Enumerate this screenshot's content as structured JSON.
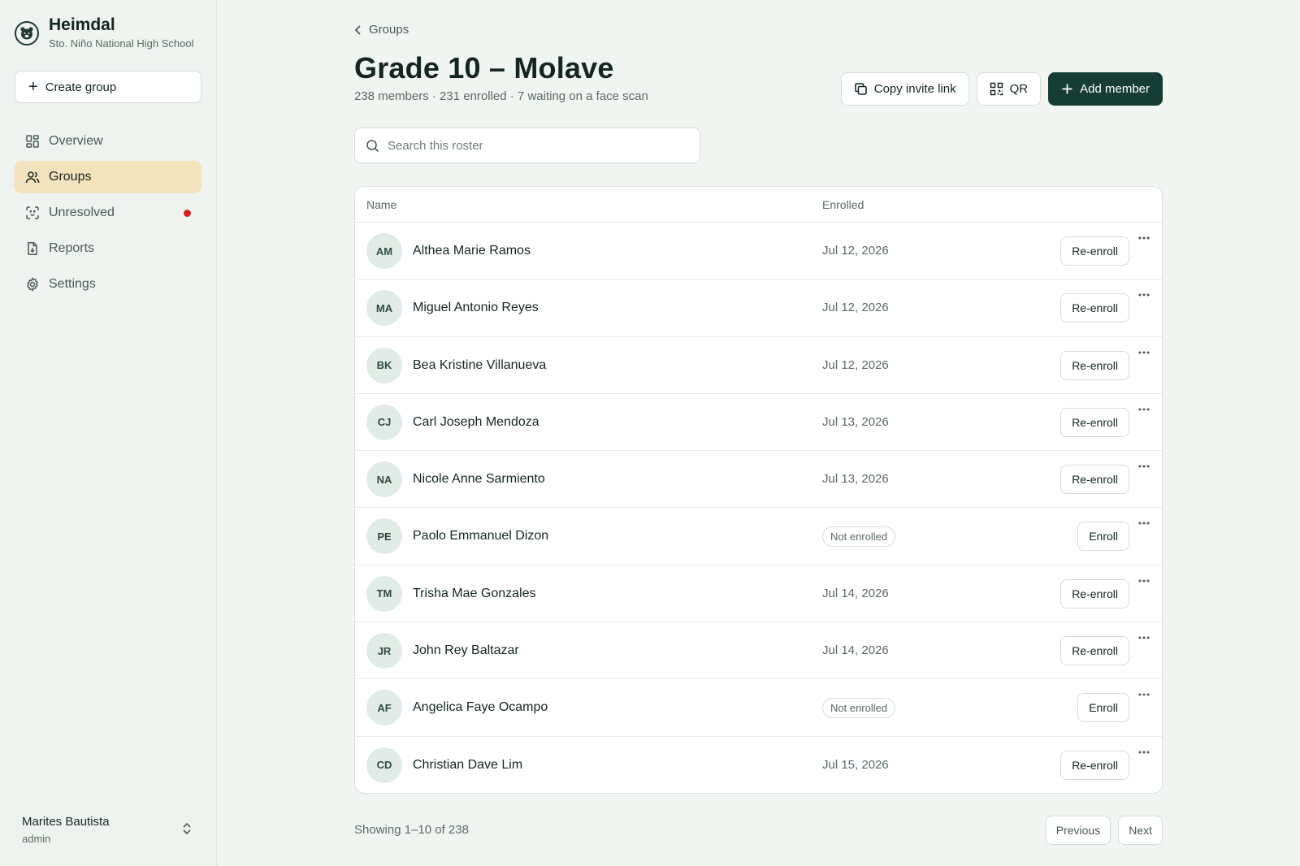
{
  "brand": {
    "name": "Heimdal",
    "school": "Sto. Niño National High School"
  },
  "sidebar": {
    "create_label": "Create group",
    "items": [
      {
        "label": "Overview",
        "icon": "grid-icon",
        "active": false
      },
      {
        "label": "Groups",
        "icon": "users-icon",
        "active": true
      },
      {
        "label": "Unresolved",
        "icon": "face-scan-icon",
        "active": false,
        "alert": true
      },
      {
        "label": "Reports",
        "icon": "report-icon",
        "active": false
      },
      {
        "label": "Settings",
        "icon": "gear-icon",
        "active": false
      }
    ]
  },
  "user": {
    "name": "Marites Bautista",
    "role": "admin"
  },
  "breadcrumb": {
    "label": "Groups"
  },
  "page": {
    "title": "Grade 10 – Molave",
    "subtitle": "238 members · 231 enrolled · 7 waiting on a face scan"
  },
  "actions": {
    "copy_label": "Copy invite link",
    "qr_label": "QR",
    "add_label": "Add member"
  },
  "search": {
    "placeholder": "Search this roster",
    "value": ""
  },
  "table": {
    "columns": {
      "name": "Name",
      "enrolled": "Enrolled"
    },
    "rows": [
      {
        "initials": "AM",
        "name": "Althea Marie Ramos",
        "enrolled": "Jul 12, 2026",
        "action": "Re-enroll"
      },
      {
        "initials": "MA",
        "name": "Miguel Antonio Reyes",
        "enrolled": "Jul 12, 2026",
        "action": "Re-enroll"
      },
      {
        "initials": "BK",
        "name": "Bea Kristine Villanueva",
        "enrolled": "Jul 12, 2026",
        "action": "Re-enroll"
      },
      {
        "initials": "CJ",
        "name": "Carl Joseph Mendoza",
        "enrolled": "Jul 13, 2026",
        "action": "Re-enroll"
      },
      {
        "initials": "NA",
        "name": "Nicole Anne Sarmiento",
        "enrolled": "Jul 13, 2026",
        "action": "Re-enroll"
      },
      {
        "initials": "PE",
        "name": "Paolo Emmanuel Dizon",
        "enrolled": "Not enrolled",
        "status": "not-enrolled",
        "action": "Enroll"
      },
      {
        "initials": "TM",
        "name": "Trisha Mae Gonzales",
        "enrolled": "Jul 14, 2026",
        "action": "Re-enroll"
      },
      {
        "initials": "JR",
        "name": "John Rey Baltazar",
        "enrolled": "Jul 14, 2026",
        "action": "Re-enroll"
      },
      {
        "initials": "AF",
        "name": "Angelica Faye Ocampo",
        "enrolled": "Not enrolled",
        "status": "not-enrolled",
        "action": "Enroll"
      },
      {
        "initials": "CD",
        "name": "Christian Dave Lim",
        "enrolled": "Jul 15, 2026",
        "action": "Re-enroll"
      }
    ]
  },
  "pagination": {
    "summary": "Showing 1–10 of 238",
    "previous_label": "Previous",
    "next_label": "Next"
  },
  "colors": {
    "primary": "#163d33",
    "active_nav": "#f4e2bd",
    "alert_dot": "#d42020",
    "background": "#f1f5f2"
  }
}
